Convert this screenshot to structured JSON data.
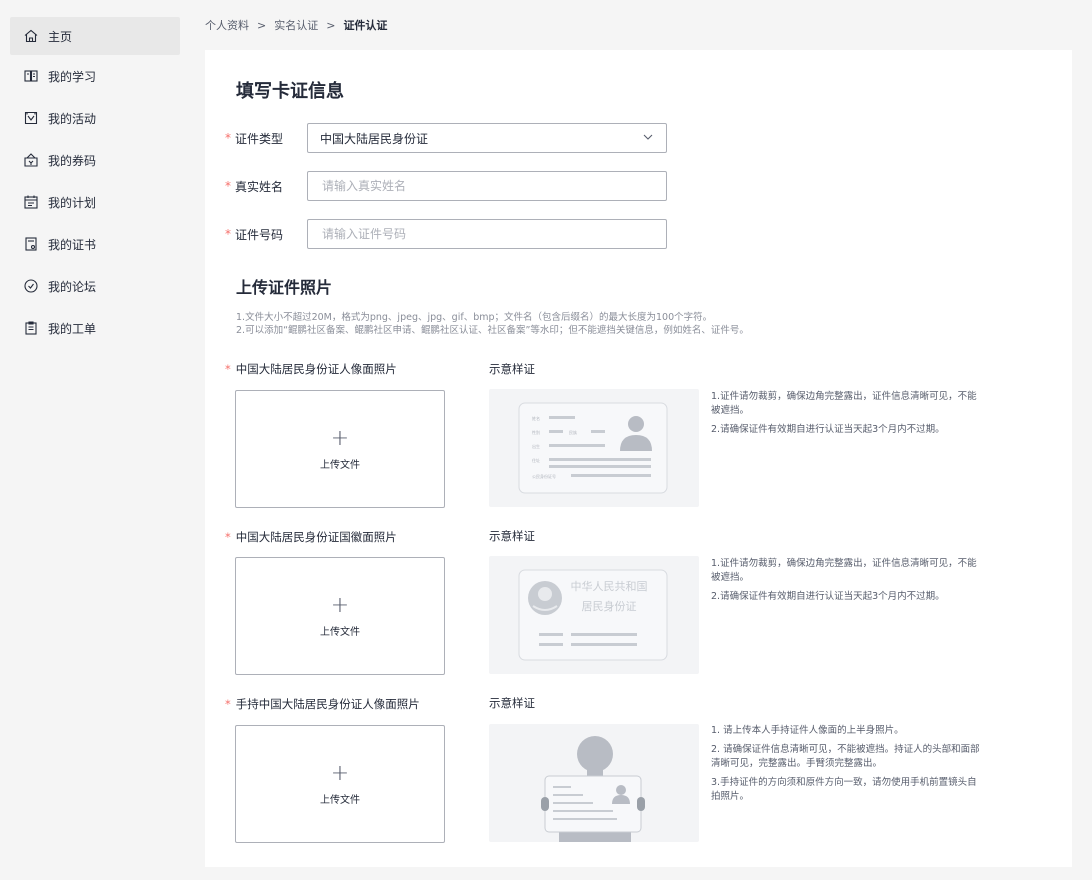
{
  "sidebar": {
    "items": [
      {
        "label": "主页",
        "icon": "home-icon"
      },
      {
        "label": "我的学习",
        "icon": "study-icon"
      },
      {
        "label": "我的活动",
        "icon": "activity-icon"
      },
      {
        "label": "我的券码",
        "icon": "coupon-icon"
      },
      {
        "label": "我的计划",
        "icon": "calendar-icon"
      },
      {
        "label": "我的证书",
        "icon": "certificate-icon"
      },
      {
        "label": "我的论坛",
        "icon": "forum-icon"
      },
      {
        "label": "我的工单",
        "icon": "ticket-icon"
      }
    ]
  },
  "breadcrumb": {
    "items": [
      "个人资料",
      "实名认证",
      "证件认证"
    ],
    "separator": ">"
  },
  "form": {
    "title": "填写卡证信息",
    "required_mark": "*",
    "fields": {
      "type": {
        "label": "证件类型",
        "value": "中国大陆居民身份证"
      },
      "name": {
        "label": "真实姓名",
        "placeholder": "请输入真实姓名"
      },
      "number": {
        "label": "证件号码",
        "placeholder": "请输入证件号码"
      }
    }
  },
  "upload": {
    "title": "上传证件照片",
    "notes": [
      "1.文件大小不超过20M，格式为png、jpeg、jpg、gif、bmp；文件名（包含后缀名）的最大长度为100个字符。",
      "2.可以添加“鲲鹏社区备案、鲲鹏社区申请、鲲鹏社区认证、社区备案”等水印；但不能遮挡关键信息，例如姓名、证件号。"
    ],
    "sample_label": "示意样证",
    "upload_text": "上传文件",
    "sections": [
      {
        "label": "中国大陆居民身份证人像面照片",
        "tips": [
          "1.证件请勿裁剪，确保边角完整露出，证件信息清晰可见，不能被遮挡。",
          "2.请确保证件有效期自进行认证当天起3个月内不过期。"
        ]
      },
      {
        "label": "中国大陆居民身份证国徽面照片",
        "tips": [
          "1.证件请勿裁剪，确保边角完整露出，证件信息清晰可见，不能被遮挡。",
          "2.请确保证件有效期自进行认证当天起3个月内不过期。"
        ]
      },
      {
        "label": "手持中国大陆居民身份证人像面照片",
        "tips": [
          "1. 请上传本人手持证件人像面的上半身照片。",
          "2. 请确保证件信息清晰可见，不能被遮挡。持证人的头部和面部清晰可见，完整露出。手臂须完整露出。",
          "3.手持证件的方向须和原件方向一致，请勿使用手机前置镜头自拍照片。"
        ]
      }
    ],
    "sample_card": {
      "front_fields": [
        "姓名",
        "性别",
        "民族",
        "出生",
        "住址",
        "公民身份证号"
      ],
      "back_line1": "中华人民共和国",
      "back_line2": "居民身份证"
    }
  },
  "colors": {
    "required": "#f66f6a",
    "border": "#adb0b8",
    "placeholder": "#adb0b8",
    "sample_bg": "#f3f4f6"
  }
}
